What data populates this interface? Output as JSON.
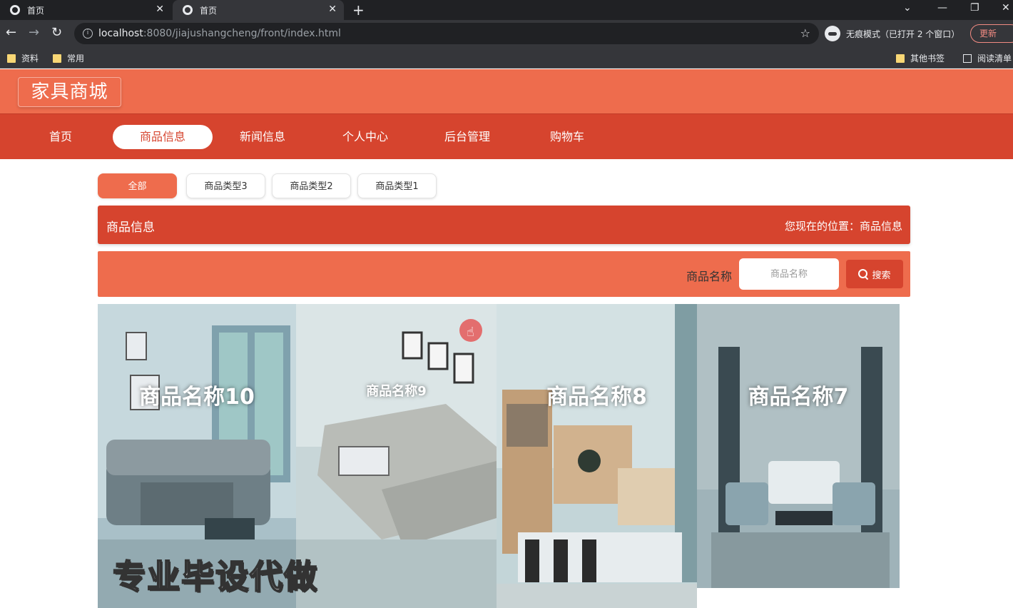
{
  "browser": {
    "tabs": [
      {
        "title": "首页",
        "active": false
      },
      {
        "title": "首页",
        "active": true
      }
    ],
    "url_host": "localhost",
    "url_path": ":8080/jiajushangcheng/front/index.html",
    "incognito_label": "无痕模式（已打开 2 个窗口）",
    "update_label": "更新",
    "bookmarks": [
      "资料",
      "常用"
    ],
    "bookmarks_right": [
      "其他书签",
      "阅读清单"
    ]
  },
  "site": {
    "logo": "家具商城",
    "nav": [
      "首页",
      "商品信息",
      "新闻信息",
      "个人中心",
      "后台管理",
      "购物车"
    ],
    "active_nav": "商品信息",
    "categories": [
      "全部",
      "商品类型3",
      "商品类型2",
      "商品类型1"
    ],
    "active_category": "全部",
    "crumb_title": "商品信息",
    "crumb_location": "您现在的位置：商品信息",
    "search_label": "商品名称",
    "search_placeholder": "商品名称",
    "search_button": "搜索",
    "products": [
      "商品名称10",
      "商品名称9",
      "商品名称8",
      "商品名称7"
    ],
    "watermark": "专业毕设代做"
  },
  "colors": {
    "header": "#ee6c4d",
    "nav": "#d6442e",
    "accent": "#ee6c4d"
  }
}
